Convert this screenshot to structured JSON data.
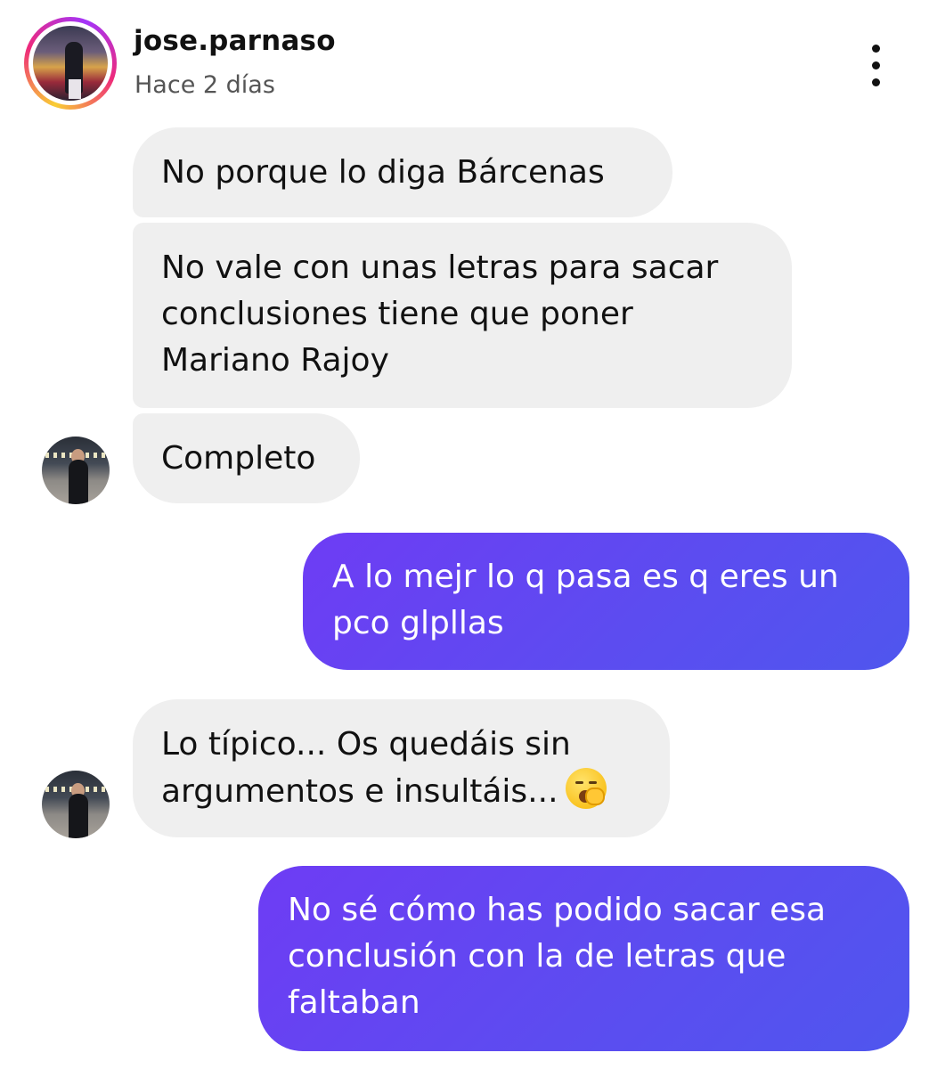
{
  "header": {
    "username": "jose.parnaso",
    "time": "Hace 2 días",
    "menu_icon": "more-vertical-icon"
  },
  "messages": [
    {
      "from": "them",
      "lines": [
        "No porque lo diga Bárcenas"
      ]
    },
    {
      "from": "them",
      "lines": [
        "No vale con unas letras para sacar",
        "conclusiones tiene que poner",
        "Mariano Rajoy"
      ]
    },
    {
      "from": "them",
      "lines": [
        "Completo"
      ]
    },
    {
      "from": "me",
      "lines": [
        "A lo mejr lo q pasa es q eres un",
        "pco glpllas"
      ]
    },
    {
      "from": "them",
      "lines": [
        "Lo típico... Os quedáis sin",
        "argumentos e insultáis..."
      ],
      "emoji": "yawning-face-icon"
    },
    {
      "from": "me",
      "lines": [
        "No sé cómo has podido sacar esa",
        "conclusión con la de letras que",
        "faltaban"
      ]
    }
  ],
  "colors": {
    "incoming_bubble": "#efefef",
    "outgoing_bubble_start": "#6e3cf4",
    "outgoing_bubble_end": "#4f56ee"
  }
}
